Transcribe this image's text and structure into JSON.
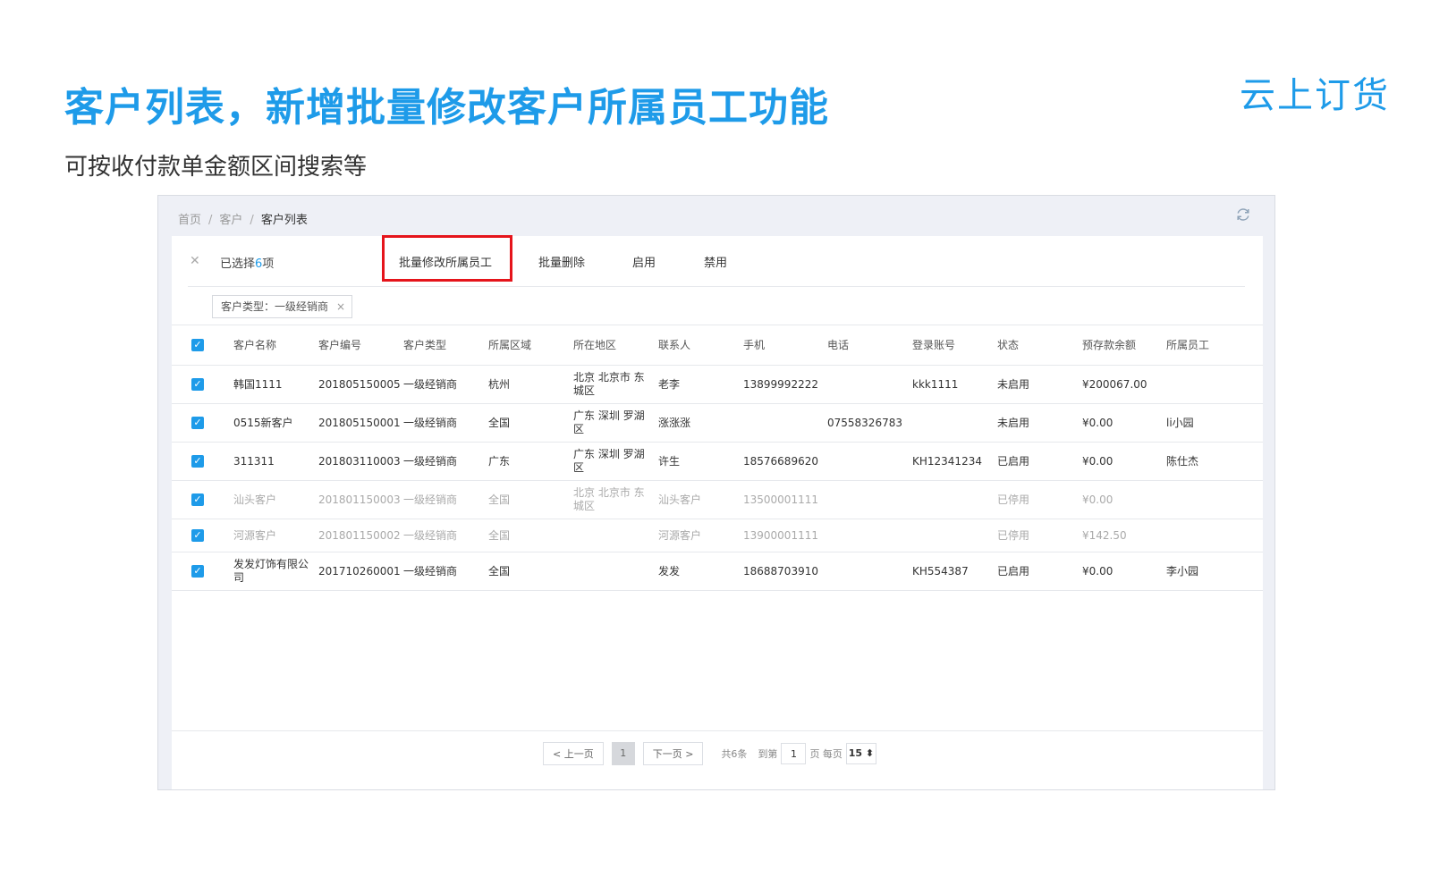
{
  "slide": {
    "title": "客户列表，新增批量修改客户所属员工功能",
    "subtitle": "可按收付款单金额区间搜索等",
    "brand": "云上订货"
  },
  "breadcrumb": {
    "home": "首页",
    "parent": "客户",
    "current": "客户列表",
    "sep": "/"
  },
  "toolbar": {
    "selected_prefix": "已选择",
    "selected_count": "6",
    "selected_suffix": "项",
    "batch_edit_staff": "批量修改所属员工",
    "batch_delete": "批量删除",
    "enable": "启用",
    "disable": "禁用"
  },
  "filter": {
    "tag": "客户类型：一级经销商",
    "close": "×"
  },
  "table": {
    "headers": [
      "客户名称",
      "客户编号",
      "客户类型",
      "所属区域",
      "所在地区",
      "联系人",
      "手机",
      "电话",
      "登录账号",
      "状态",
      "预存款余额",
      "所属员工"
    ],
    "rows": [
      [
        "韩国1111",
        "201805150005",
        "一级经销商",
        "杭州",
        "北京 北京市 东城区",
        "老李",
        "13899992222",
        "",
        "kkk1111",
        "未启用",
        "¥200067.00",
        ""
      ],
      [
        "0515新客户",
        "201805150001",
        "一级经销商",
        "全国",
        "广东 深圳 罗湖区",
        "涨涨涨",
        "",
        "07558326783",
        "",
        "未启用",
        "¥0.00",
        "li小园"
      ],
      [
        "311311",
        "201803110003",
        "一级经销商",
        "广东",
        "广东 深圳 罗湖区",
        "许生",
        "18576689620",
        "",
        "KH12341234",
        "已启用",
        "¥0.00",
        "陈仕杰"
      ],
      [
        "汕头客户",
        "201801150003",
        "一级经销商",
        "全国",
        "北京 北京市 东城区",
        "汕头客户",
        "13500001111",
        "",
        "",
        "已停用",
        "¥0.00",
        ""
      ],
      [
        "河源客户",
        "201801150002",
        "一级经销商",
        "全国",
        "",
        "河源客户",
        "13900001111",
        "",
        "",
        "已停用",
        "¥142.50",
        ""
      ],
      [
        "发发灯饰有限公司",
        "201710260001",
        "一级经销商",
        "全国",
        "",
        "发发",
        "18688703910",
        "",
        "KH554387",
        "已启用",
        "¥0.00",
        "李小园"
      ]
    ]
  },
  "pagination": {
    "prev": "< 上一页",
    "current": "1",
    "next": "下一页 >",
    "total": "共6条",
    "goto": "到第",
    "page_value": "1",
    "page_per": "页 每页",
    "page_size": "15 ⬍"
  },
  "colors": {
    "accent": "#1e9be9",
    "highlight": "#e5141b"
  }
}
